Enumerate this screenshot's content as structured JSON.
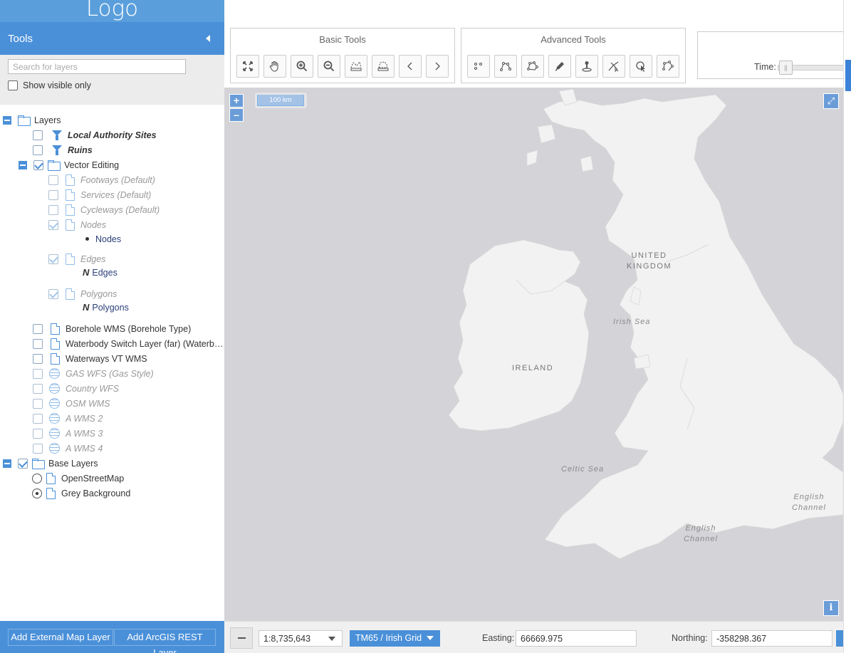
{
  "logo": "Logo",
  "sidebar": {
    "title": "Tools",
    "search_placeholder": "Search for layers",
    "visible_only_label": "Show visible only",
    "tree": {
      "root_label": "Layers",
      "local_authority_sites": "Local Authority Sites",
      "ruins": "Ruins",
      "vector_editing": "Vector Editing",
      "footways": "Footways (Default)",
      "services": "Services (Default)",
      "cycleways": "Cycleways (Default)",
      "nodes": "Nodes",
      "nodes_legend": "Nodes",
      "edges": "Edges",
      "edges_legend": "Edges",
      "polygons": "Polygons",
      "polygons_legend": "Polygons",
      "legend_line_icon": "N",
      "borehole": "Borehole WMS (Borehole Type)",
      "waterbody": "Waterbody Switch Layer (far) (Waterb…",
      "waterways": "Waterways VT WMS",
      "gas_wfs": "GAS WFS (Gas Style)",
      "country_wfs": "Country WFS",
      "osm_wms": "OSM WMS",
      "a_wms_2": "A WMS 2",
      "a_wms_3": "A WMS 3",
      "a_wms_4": "A WMS 4",
      "base_layers": "Base Layers",
      "openstreetmap": "OpenStreetMap",
      "grey_background": "Grey Background"
    },
    "footer": {
      "add_external": "Add External Map Layer",
      "add_arcgis": "Add ArcGIS REST Layer"
    }
  },
  "toolbar": {
    "basic_title": "Basic Tools",
    "advanced_title": "Advanced Tools",
    "basic_tools": [
      "zoom-to-extent-icon",
      "pan-hand-icon",
      "zoom-in-icon",
      "zoom-out-icon",
      "measure-length-icon",
      "measure-area-icon",
      "previous-extent-icon",
      "next-extent-icon"
    ],
    "advanced_tools": [
      "draw-point-icon",
      "draw-line-icon",
      "draw-polygon-icon",
      "edit-pencil-icon",
      "pin-icon",
      "select-geometry-icon",
      "pointer-query-icon",
      "modify-vertex-icon"
    ],
    "time_label": "Time:",
    "time_handle": "||"
  },
  "map": {
    "zoom_in": "+",
    "zoom_out": "–",
    "scale_line": "100 km",
    "fullscreen": "⤢",
    "attribution": "i",
    "labels": {
      "united_kingdom_1": "UNITED",
      "united_kingdom_2": "KINGDOM",
      "ireland": "IRELAND",
      "irish_sea": "Irish Sea",
      "celtic_sea": "Celtic Sea",
      "english_channel_1_a": "English",
      "english_channel_1_b": "Channel",
      "english_channel_2_a": "English",
      "english_channel_2_b": "Channel"
    },
    "colors": {
      "sea": "#d4d4d8",
      "land": "#f2f2f2",
      "border": "#d8d8d8"
    }
  },
  "bottombar": {
    "scale_value": "1:8,735,643",
    "projection": "TM65 / Irish Grid",
    "easting_label": "Easting:",
    "easting_value": "66669.975",
    "northing_label": "Northing:",
    "northing_value": "-358298.367"
  },
  "colors": {
    "accent": "#4a90d9",
    "accent_dark": "#3b82d8"
  }
}
